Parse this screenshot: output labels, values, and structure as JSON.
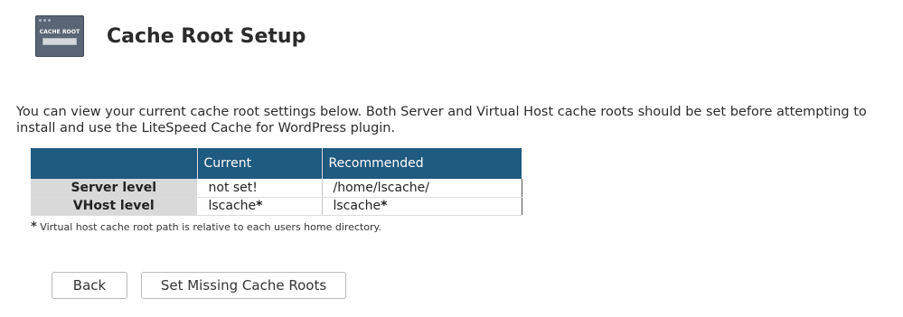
{
  "header": {
    "icon_text": "CACHE ROOT",
    "title": "Cache Root Setup"
  },
  "intro": "You can view your current cache root settings below. Both Server and Virtual Host cache roots should be set before attempting to install and use the LiteSpeed Cache for WordPress plugin.",
  "table": {
    "columns": [
      "",
      "Current",
      "Recommended"
    ],
    "rows": [
      {
        "label": "Server level",
        "current": "not set!",
        "recommended": "/home/lscache/"
      },
      {
        "label": "VHost level",
        "current": "lscache",
        "current_mark": "*",
        "recommended": "lscache",
        "recommended_mark": "*"
      }
    ]
  },
  "note": {
    "mark": "*",
    "text": " Virtual host cache root path is relative to each users home directory."
  },
  "buttons": {
    "back": "Back",
    "set_missing": "Set Missing Cache Roots"
  }
}
